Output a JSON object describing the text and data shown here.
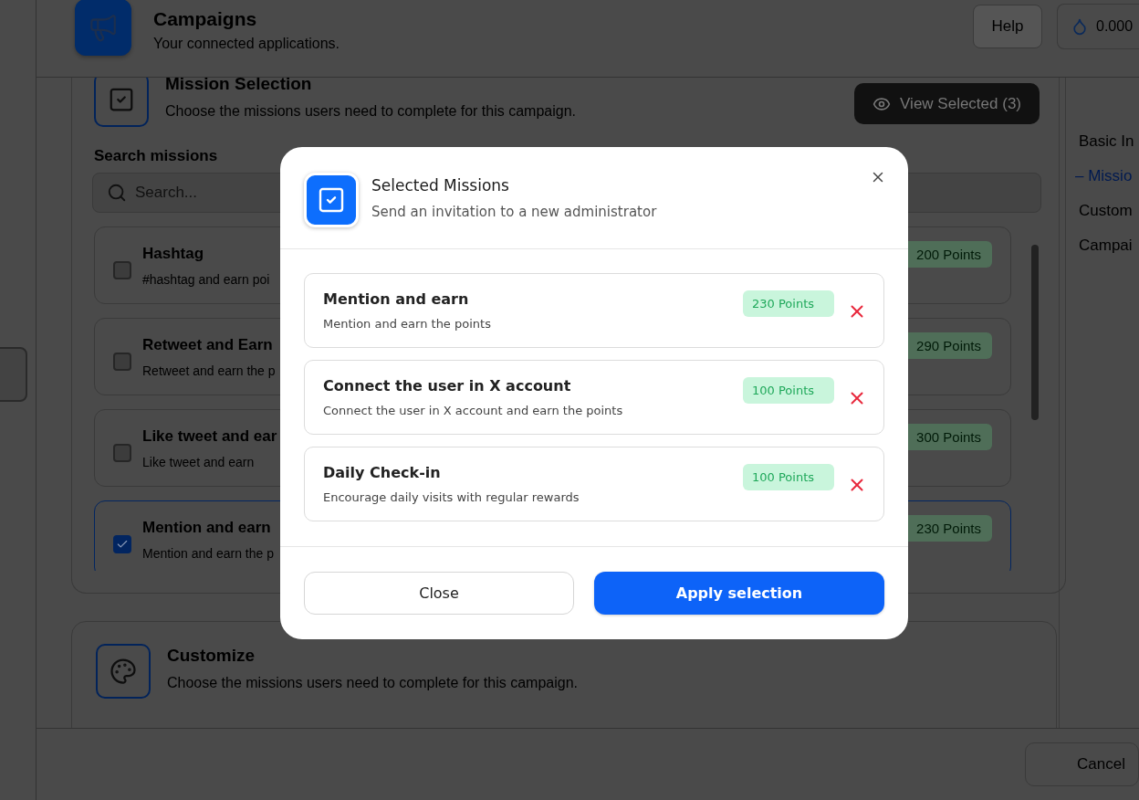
{
  "header": {
    "title": "Campaigns",
    "subtitle": "Your connected applications.",
    "help_button": "Help",
    "balance": "0.000"
  },
  "mission_section": {
    "title": "Mission Selection",
    "subtitle": "Choose the missions users need to complete for this campaign.",
    "view_selected_button": "View Selected (3)",
    "search_label": "Search missions",
    "search": {
      "placeholder": "Search..."
    },
    "missions": [
      {
        "title": "Hashtag",
        "description": "#hashtag and earn poi",
        "points": "200 Points",
        "checked": false
      },
      {
        "title": "Retweet and Earn",
        "description": "Retweet and earn the p",
        "points": "290 Points",
        "checked": false
      },
      {
        "title": "Like tweet and ear",
        "description": "Like tweet and earn",
        "points": "300 Points",
        "checked": false
      },
      {
        "title": "Mention and earn",
        "description": "Mention and earn the p",
        "points": "230 Points",
        "checked": true
      }
    ]
  },
  "customize_section": {
    "title": "Customize",
    "subtitle": "Choose the missions users need to complete for this campaign."
  },
  "side_nav": [
    {
      "label": "Basic In",
      "selected": false
    },
    {
      "label": "– Missio",
      "selected": true
    },
    {
      "label": "Custom",
      "selected": false
    },
    {
      "label": "Campai",
      "selected": false
    }
  ],
  "footer": {
    "cancel_button": "Cancel"
  },
  "modal": {
    "title": "Selected Missions",
    "subtitle": "Send an invitation to a new administrator",
    "missions": [
      {
        "title": "Mention and earn",
        "description": "Mention and earn the points",
        "points": "230 Points"
      },
      {
        "title": "Connect the user in X account",
        "description": "Connect the user in X account and earn the points",
        "points": "100 Points"
      },
      {
        "title": "Daily Check-in",
        "description": "Encourage daily visits with regular rewards",
        "points": "100 Points"
      }
    ],
    "close_button": "Close",
    "apply_button": "Apply selection"
  }
}
